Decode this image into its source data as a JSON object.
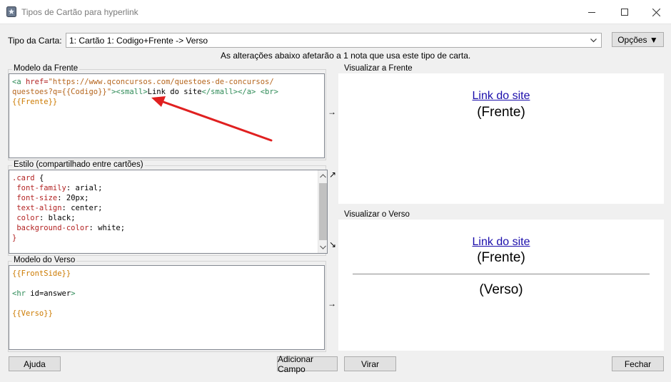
{
  "window": {
    "title": "Tipos de Cartão para hyperlink",
    "controls": [
      "minimize-icon",
      "maximize-icon",
      "close-icon"
    ]
  },
  "card_type": {
    "label": "Tipo da Carta:",
    "value": "1: Cartão 1: Codigo+Frente -> Verso",
    "options_button": "Opções ▼"
  },
  "notice": "As alterações abaixo afetarão a 1 nota que usa este tipo de carta.",
  "front_template": {
    "label": "Modelo da Frente",
    "lines": [
      "<a href=\"https://www.qconcursos.com/questoes-de-concursos/",
      "questoes?q={{Codigo}}\"><small>Link do site</small></a> <br>",
      "{{Frente}}"
    ]
  },
  "styling": {
    "label": "Estilo (compartilhado entre cartões)",
    "lines": [
      ".card {",
      " font-family: arial;",
      " font-size: 20px;",
      " text-align: center;",
      " color: black;",
      " background-color: white;",
      "}"
    ]
  },
  "back_template": {
    "label": "Modelo do Verso",
    "lines": [
      "{{FrontSide}}",
      "",
      "<hr id=answer>",
      "",
      "{{Verso}}"
    ]
  },
  "front_preview": {
    "label": "Visualizar a Frente",
    "link": "Link do site",
    "text": "(Frente)"
  },
  "back_preview": {
    "label": "Visualizar o Verso",
    "link": "Link do site",
    "front_text": "(Frente)",
    "back_text": "(Verso)"
  },
  "arrows": {
    "front": "→",
    "style_up": "↗",
    "style_down": "↘",
    "back": "→"
  },
  "buttons": {
    "help": "Ajuda",
    "add_field": "Adicionar Campo",
    "flip": "Virar",
    "close": "Fechar"
  },
  "annotation": {
    "color": "#e02020",
    "icon": "red-arrow-annotation"
  }
}
